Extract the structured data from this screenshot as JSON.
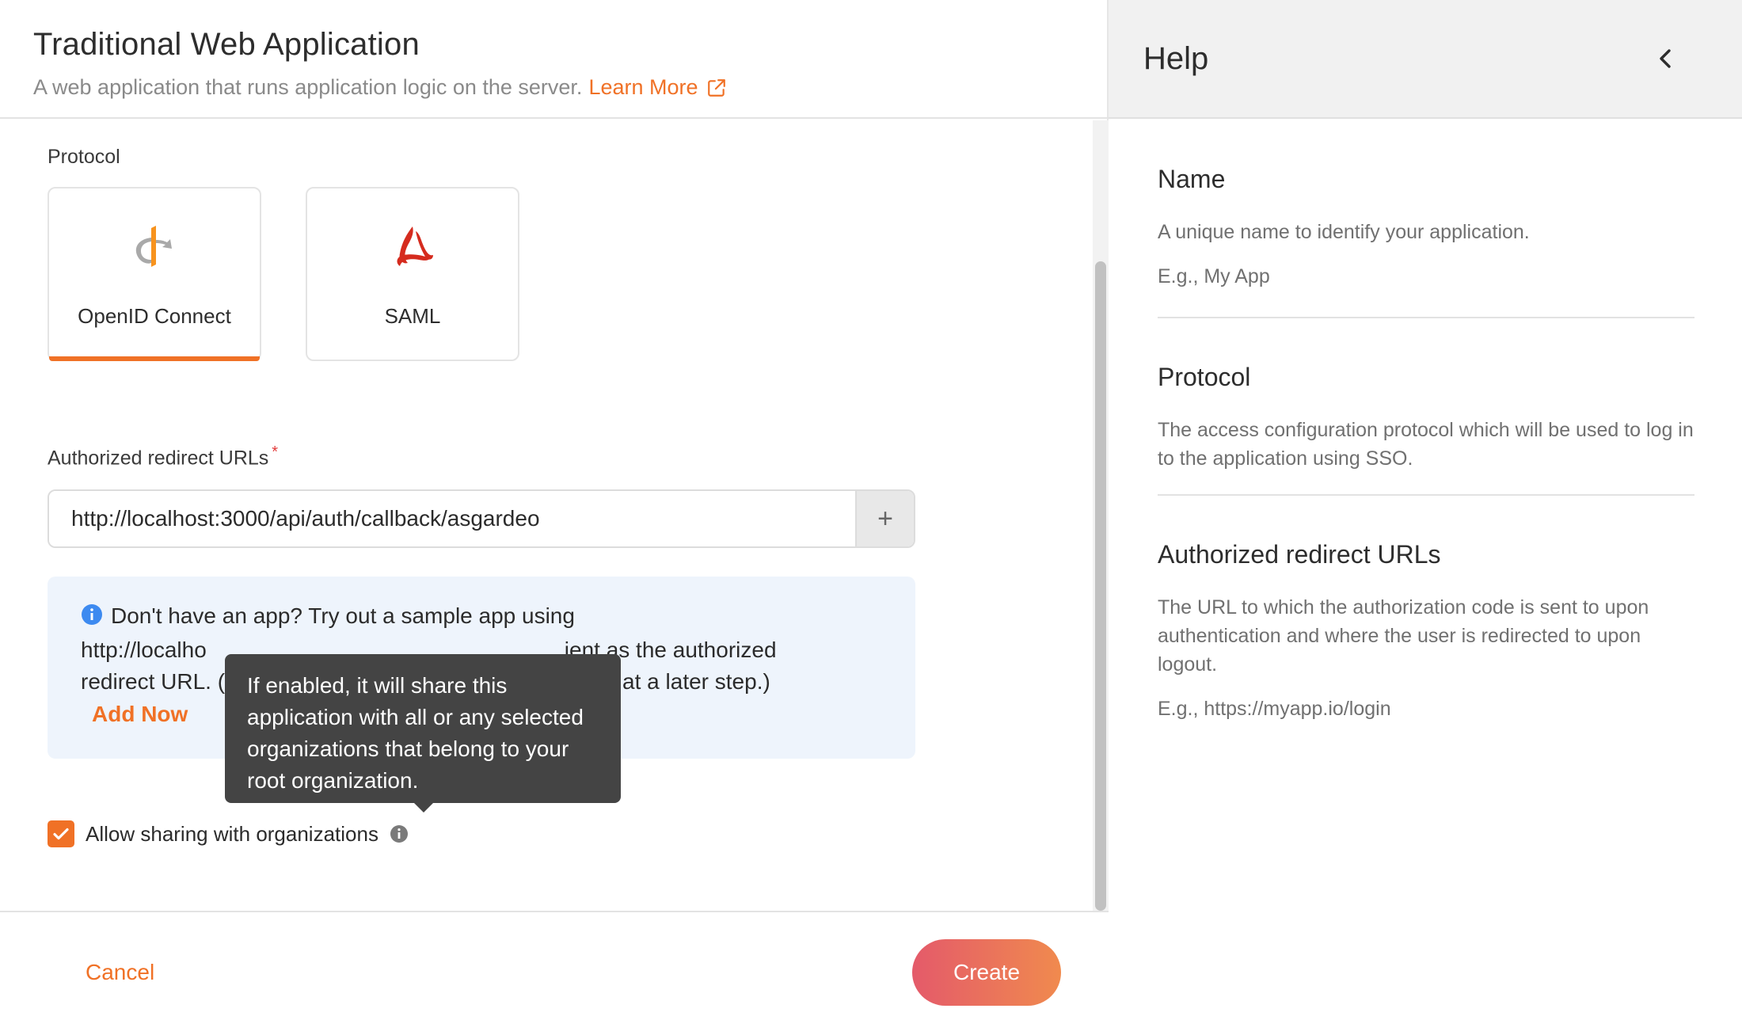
{
  "header": {
    "title": "Traditional Web Application",
    "subtitle": "A web application that runs application logic on the server.",
    "learn_more": "Learn More"
  },
  "form": {
    "protocol_label": "Protocol",
    "protocols": [
      {
        "label": "OpenID Connect",
        "selected": true,
        "icon": "openid-icon"
      },
      {
        "label": "SAML",
        "selected": false,
        "icon": "saml-icon"
      }
    ],
    "redirect_label": "Authorized redirect URLs",
    "required_marker": "*",
    "redirect_value": "http://localhost:3000/api/auth/callback/asgardeo",
    "add_url_symbol": "+",
    "info_visible_line1": "Don't have an app? Try out a sample app using",
    "info_visible_line2a": "http://localho",
    "info_visible_line2b": "ient as the authorized",
    "info_visible_line3a": "redirect URL. (",
    "info_visible_line3b": "at a later step.)",
    "add_now": "Add Now",
    "tooltip": "If enabled, it will share this application with all or any selected organizations that belong to your root organization.",
    "share_label": "Allow sharing with organizations",
    "share_checked": true
  },
  "footer": {
    "cancel": "Cancel",
    "create": "Create"
  },
  "help": {
    "title": "Help",
    "sections": [
      {
        "heading": "Name",
        "description": "A unique name to identify your application.",
        "example": "E.g., My App"
      },
      {
        "heading": "Protocol",
        "description": "The access configuration protocol which will be used to log in to the application using SSO.",
        "example": ""
      },
      {
        "heading": "Authorized redirect URLs",
        "description": "The URL to which the authorization code is sent to upon authentication and where the user is redirected to upon logout.",
        "example": "E.g., https://myapp.io/login"
      }
    ]
  },
  "colors": {
    "accent": "#f07126",
    "tooltip_bg": "#444444",
    "info_bg": "#eef4fc",
    "create_gradient_start": "#e45a6a",
    "create_gradient_end": "#f08a4e"
  }
}
